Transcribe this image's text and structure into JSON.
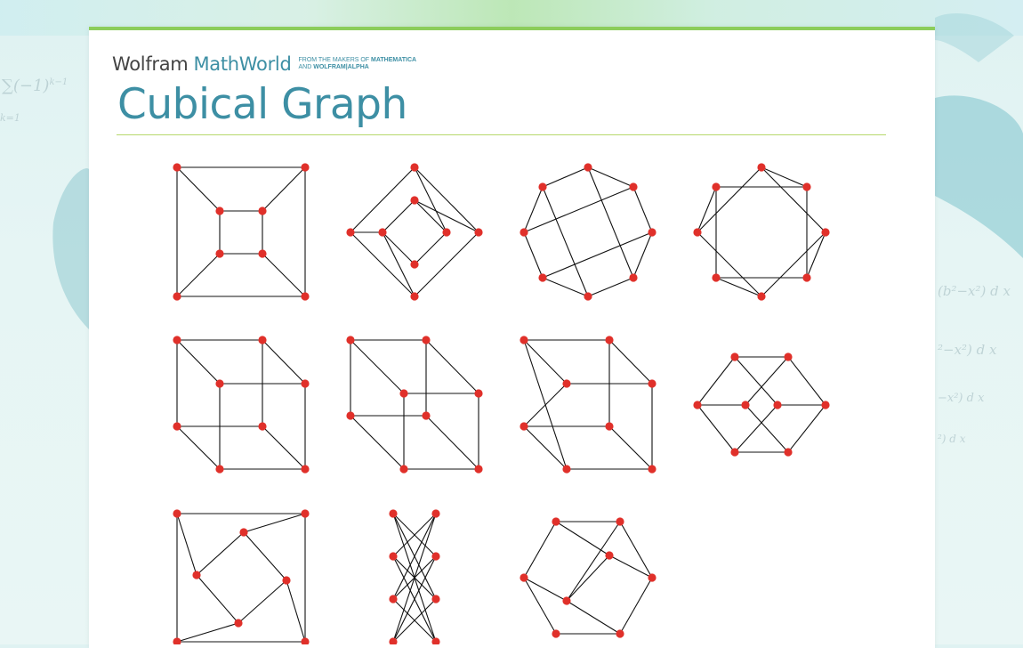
{
  "logo": {
    "wolfram": "Wolfram",
    "mathworld": "MathWorld",
    "tagline_line1_prefix": "FROM THE MAKERS OF ",
    "tagline_line1_bold": "MATHEMATICA",
    "tagline_line2_prefix": "AND ",
    "tagline_line2_bold": "WOLFRAM|ALPHA"
  },
  "page": {
    "title": "Cubical Graph"
  },
  "colors": {
    "accent": "#3d8fa4",
    "rule": "#b6d96d",
    "top_bar": "#8ccd5b",
    "vertex": "#e0302a",
    "edge": "#111111"
  },
  "graphs": {
    "count": 11,
    "vertices_per_graph": 8,
    "edges_per_graph": 12
  }
}
